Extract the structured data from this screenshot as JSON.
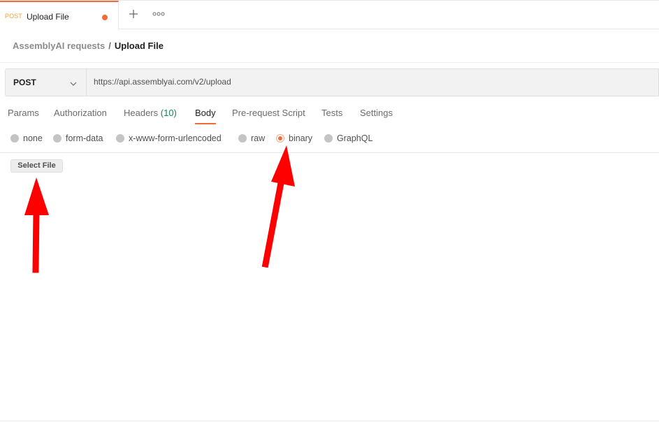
{
  "tab": {
    "method": "POST",
    "title": "Upload File",
    "unsaved": true
  },
  "tabbar": {
    "new_tab_icon": "plus-icon",
    "more_icon": "ellipsis-icon"
  },
  "breadcrumb": {
    "parent": "AssemblyAI requests",
    "separator": "/",
    "current": "Upload File"
  },
  "request": {
    "method": "POST",
    "url": "https://api.assemblyai.com/v2/upload"
  },
  "request_tabs": [
    {
      "label": "Params"
    },
    {
      "label": "Authorization"
    },
    {
      "label": "Headers",
      "count": "(10)"
    },
    {
      "label": "Body",
      "active": true
    },
    {
      "label": "Pre-request Script"
    },
    {
      "label": "Tests"
    },
    {
      "label": "Settings"
    }
  ],
  "body_types": [
    {
      "label": "none"
    },
    {
      "label": "form-data"
    },
    {
      "label": "x-www-form-urlencoded"
    },
    {
      "label": "raw"
    },
    {
      "label": "binary",
      "checked": true
    },
    {
      "label": "GraphQL"
    }
  ],
  "binary": {
    "select_file_label": "Select File"
  },
  "colors": {
    "accent": "#f26b3a",
    "method_tab": "#e9a33a",
    "headers_count": "#0f8a4f",
    "annotation_arrow": "#ff0000"
  }
}
